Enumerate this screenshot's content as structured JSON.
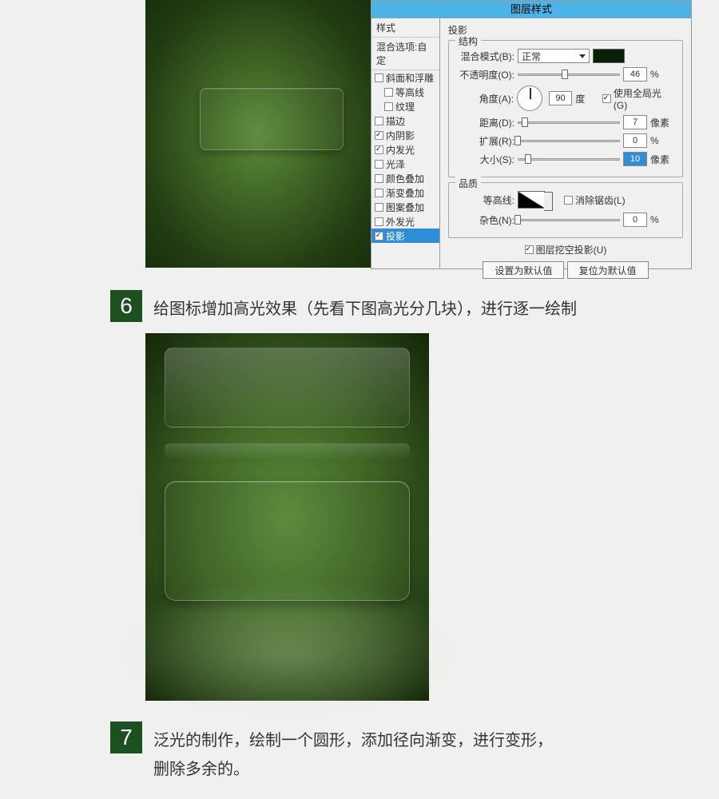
{
  "dialog": {
    "title": "图层样式",
    "styles_header": "样式",
    "blend_header": "混合选项:自定",
    "styles": [
      {
        "label": "斜面和浮雕",
        "checked": false
      },
      {
        "label": "等高线",
        "checked": false,
        "indent": true
      },
      {
        "label": "纹理",
        "checked": false,
        "indent": true
      },
      {
        "label": "描边",
        "checked": false
      },
      {
        "label": "内阴影",
        "checked": true
      },
      {
        "label": "内发光",
        "checked": true
      },
      {
        "label": "光泽",
        "checked": false
      },
      {
        "label": "颜色叠加",
        "checked": false
      },
      {
        "label": "渐变叠加",
        "checked": false
      },
      {
        "label": "图案叠加",
        "checked": false
      },
      {
        "label": "外发光",
        "checked": false
      },
      {
        "label": "投影",
        "checked": true,
        "selected": true
      }
    ],
    "shadow": {
      "section_title": "投影",
      "structure_title": "结构",
      "blend_mode_label": "混合模式(B):",
      "blend_mode_value": "正常",
      "swatch_color": "#0a1f08",
      "opacity_label": "不透明度(O):",
      "opacity_value": "46",
      "opacity_unit": "%",
      "angle_label": "角度(A):",
      "angle_value": "90",
      "angle_unit": "度",
      "global_light": "使用全局光(G)",
      "distance_label": "距离(D):",
      "distance_value": "7",
      "distance_unit": "像素",
      "spread_label": "扩展(R):",
      "spread_value": "0",
      "spread_unit": "%",
      "size_label": "大小(S):",
      "size_value": "10",
      "size_unit": "像素",
      "quality_title": "品质",
      "contour_label": "等高线:",
      "antialias_label": "消除锯齿(L)",
      "noise_label": "杂色(N):",
      "noise_value": "0",
      "noise_unit": "%",
      "knockout_label": "图层挖空投影(U)",
      "btn_default": "设置为默认值",
      "btn_reset": "复位为默认值"
    }
  },
  "step6": {
    "num": "6",
    "text": "给图标增加高光效果（先看下图高光分几块），进行逐一绘制"
  },
  "step7": {
    "num": "7",
    "text1": "泛光的制作，绘制一个圆形，添加径向渐变，进行变形，",
    "text2": "删除多余的。"
  }
}
